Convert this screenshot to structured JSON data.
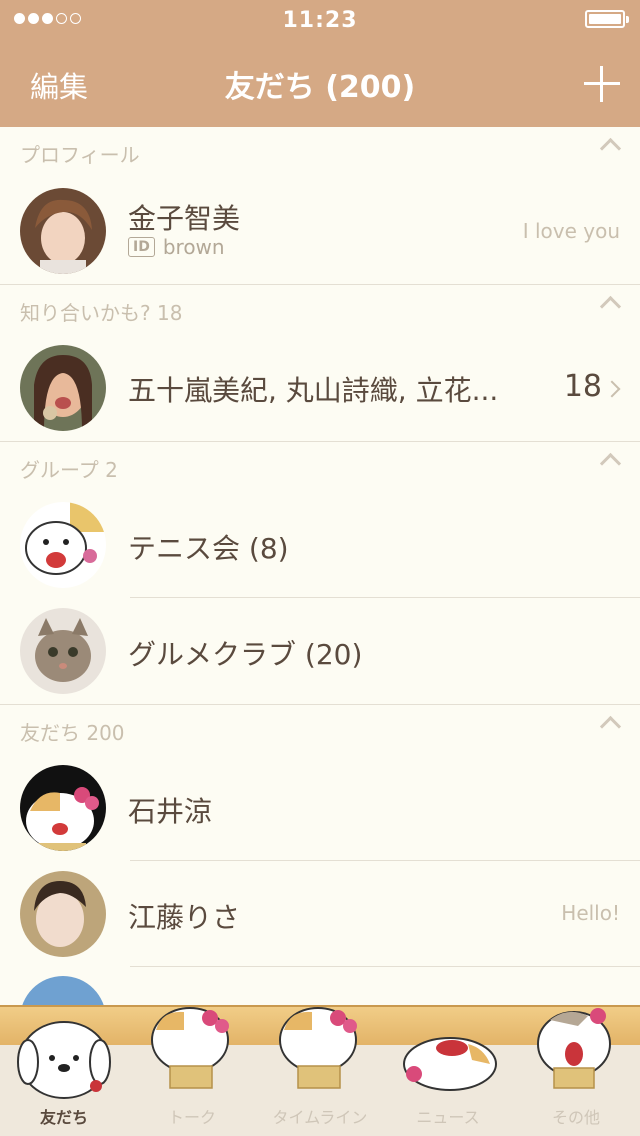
{
  "status": {
    "time": "11:23"
  },
  "nav": {
    "edit": "編集",
    "title": "友だち (200)"
  },
  "sections": {
    "profile": {
      "label": "プロフィール"
    },
    "suggest": {
      "label": "知り合いかも? 18"
    },
    "groups": {
      "label": "グループ 2"
    },
    "friends": {
      "label": "友だち 200"
    }
  },
  "profile": {
    "name": "金子智美",
    "id_badge": "ID",
    "id": "brown",
    "status": "I love you"
  },
  "suggest": {
    "names": "五十嵐美紀, 丸山詩織, 立花...",
    "count": "18"
  },
  "groups": [
    {
      "name": "テニス会 (8)"
    },
    {
      "name": "グルメクラブ (20)"
    }
  ],
  "friends": [
    {
      "name": "石井涼",
      "status": ""
    },
    {
      "name": "江藤りさ",
      "status": "Hello!"
    }
  ],
  "tabs": [
    {
      "label": "友だち",
      "icon": "dog-character-icon"
    },
    {
      "label": "トーク",
      "icon": "cat-character-icon"
    },
    {
      "label": "タイムライン",
      "icon": "cat-character-icon"
    },
    {
      "label": "ニュース",
      "icon": "cat-character-icon"
    },
    {
      "label": "その他",
      "icon": "cat-character-icon"
    }
  ],
  "colors": {
    "header": "#d5a985",
    "background": "#fdfcf3",
    "text": "#5a4a3e",
    "muted": "#c9bfae"
  }
}
